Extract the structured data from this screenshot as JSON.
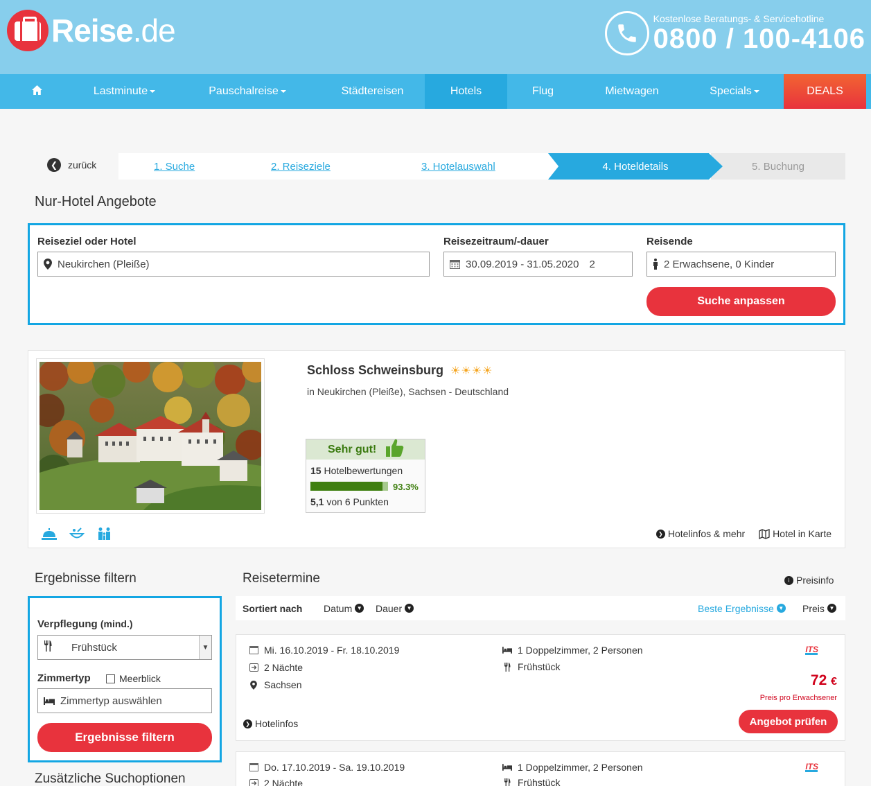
{
  "header": {
    "logo_main": "Reise",
    "logo_tld": ".de",
    "hotline_label": "Kostenlose Beratungs- & Servicehotline",
    "hotline_number": "0800 / 100-4106"
  },
  "nav": {
    "items": [
      {
        "label": "Lastminute"
      },
      {
        "label": "Pauschalreise"
      },
      {
        "label": "Städtereisen"
      },
      {
        "label": "Hotels"
      },
      {
        "label": "Flug"
      },
      {
        "label": "Mietwagen"
      },
      {
        "label": "Specials"
      },
      {
        "label": "DEALS"
      }
    ]
  },
  "steps": {
    "back": "zurück",
    "s1": "1. Suche",
    "s2": "2. Reiseziele",
    "s3": "3. Hotelauswahl",
    "s4": "4. Hoteldetails",
    "s5": "5. Buchung"
  },
  "page_title": "Nur-Hotel Angebote",
  "search": {
    "dest_label": "Reiseziel oder Hotel",
    "dest_value": "Neukirchen (Pleiße)",
    "date_label": "Reisezeitraum/-dauer",
    "date_value": "30.09.2019 - 31.05.2020",
    "duration_value": "2",
    "travelers_label": "Reisende",
    "travelers_value": "2 Erwachsene, 0 Kinder",
    "submit": "Suche anpassen"
  },
  "hotel": {
    "name": "Schloss Schweinsburg",
    "stars": "☀☀☀☀",
    "location": "in Neukirchen (Pleiße), Sachsen - Deutschland",
    "rating_label": "Sehr gut!",
    "reviews_count": "15",
    "reviews_label": "Hotelbewertungen",
    "recommend_pct": "93.3%",
    "recommend_fraction": 0.933,
    "score": "5,1",
    "score_label": "von 6 Punkten",
    "link_info": "Hotelinfos & mehr",
    "link_map": "Hotel in Karte"
  },
  "filter": {
    "title": "Ergebnisse filtern",
    "board_label": "Verpflegung",
    "board_sub": "(mind.)",
    "board_value": "Frühstück",
    "room_label": "Zimmertyp",
    "seaview": "Meerblick",
    "room_placeholder": "Zimmertyp auswählen",
    "submit": "Ergebnisse filtern",
    "more_options": "Zusätzliche Suchoptionen"
  },
  "results": {
    "title": "Reisetermine",
    "price_info": "Preisinfo",
    "sort_label": "Sortiert nach",
    "sort_date": "Datum",
    "sort_duration": "Dauer",
    "sort_best": "Beste Ergebnisse",
    "sort_price": "Preis",
    "items": [
      {
        "dates": "Mi. 16.10.2019 - Fr. 18.10.2019",
        "nights": "2 Nächte",
        "region": "Sachsen",
        "room": "1 Doppelzimmer, 2 Personen",
        "board": "Frühstück",
        "operator": "ITS",
        "price": "72",
        "currency": "€",
        "price_note": "Preis pro Erwachsener",
        "info_link": "Hotelinfos",
        "cta": "Angebot prüfen"
      },
      {
        "dates": "Do. 17.10.2019 - Sa. 19.10.2019",
        "nights": "2 Nächte",
        "room": "1 Doppelzimmer, 2 Personen",
        "board": "Frühstück",
        "operator": "ITS"
      }
    ]
  }
}
